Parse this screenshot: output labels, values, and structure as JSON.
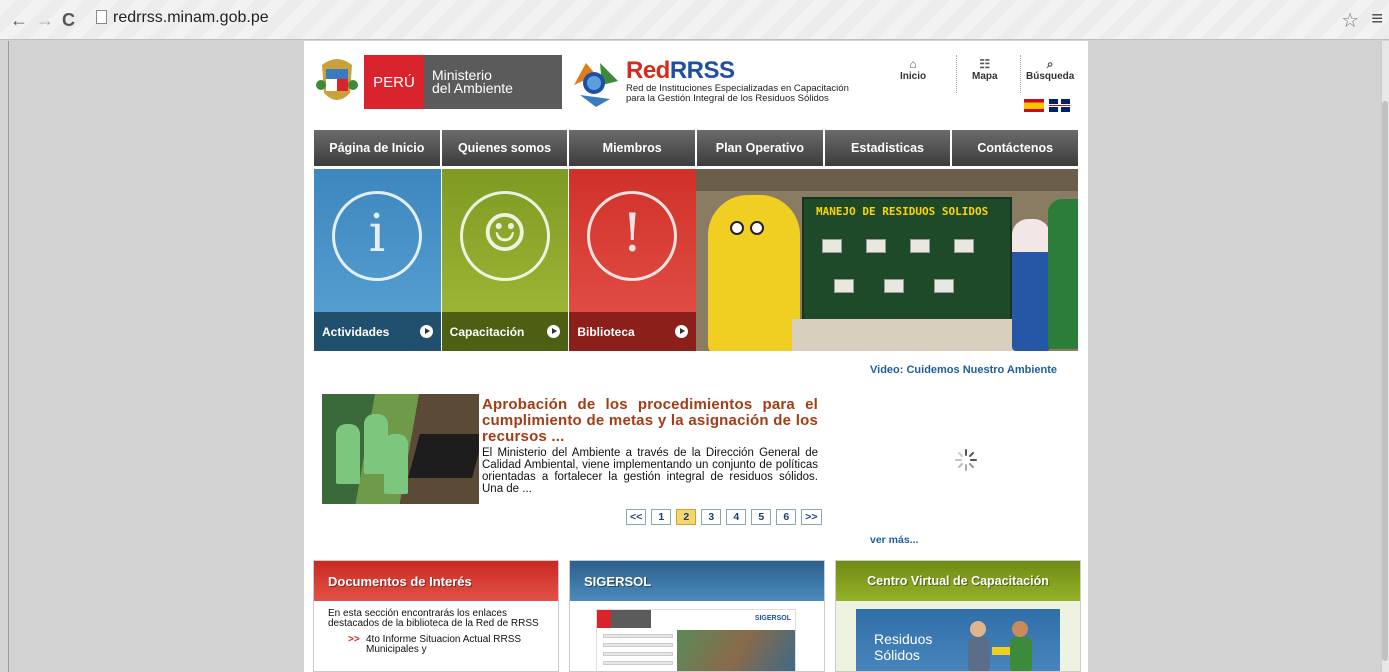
{
  "browser": {
    "url": "redrrss.minam.gob.pe",
    "back_glyph": "←",
    "forward_glyph": "→",
    "reload_glyph": "C",
    "star_glyph": "☆",
    "menu_glyph": "≡"
  },
  "header": {
    "peru_label": "PERÚ",
    "ministerio_line1": "Ministerio",
    "ministerio_line2": "del Ambiente",
    "rrss_title_red": "Red",
    "rrss_title_blue": "RRSS",
    "rrss_sub_line1": "Red de Instituciones Especializadas en Capacitación",
    "rrss_sub_line2": "para la Gestión Integral de los Residuos Sólidos",
    "toplinks": [
      {
        "label": "Inicio",
        "icon": "home-icon",
        "glyph": "⌂"
      },
      {
        "label": "Mapa",
        "icon": "sitemap-icon",
        "glyph": "☷"
      },
      {
        "label": "Búsqueda",
        "icon": "search-icon",
        "glyph": "⌕"
      }
    ]
  },
  "menu": [
    "Página de Inicio",
    "Quienes somos",
    "Miembros",
    "Plan Operativo",
    "Estadisticas",
    "Contáctenos"
  ],
  "tiles": [
    {
      "label": "Actividades",
      "icon": "info-icon",
      "glyph": "i"
    },
    {
      "label": "Capacitación",
      "icon": "smiley-icon",
      "glyph": "☺"
    },
    {
      "label": "Biblioteca",
      "icon": "alert-icon",
      "glyph": "!"
    }
  ],
  "photo": {
    "board_title": "MANEJO DE RESIDUOS SOLIDOS"
  },
  "video_link": "Video: Cuidemos Nuestro Ambiente",
  "news": {
    "title": "Aprobación de los procedimientos para el cumplimiento de metas y la asignación de los recursos ...",
    "body": "El Ministerio del Ambiente a través de la Dirección General de Calidad Ambiental, viene implementando un conjunto de políticas orientadas a fortalecer la gestión integral de residuos sólidos. Una de ...",
    "pager": [
      "<<",
      "1",
      "2",
      "3",
      "4",
      "5",
      "6",
      ">>"
    ],
    "active_page": "2"
  },
  "ver_mas": "ver más...",
  "boxes": {
    "documentos": {
      "title": "Documentos de Interés",
      "desc": "En esta sección encontrarás los enlaces destacados de la biblioteca de la Red de RRSS",
      "items": [
        {
          "arrow": ">>",
          "text": "4to Informe Situacion Actual RRSS Municipales y"
        }
      ]
    },
    "sigersol": {
      "title": "SIGERSOL",
      "shot_label": "SIGERSOL"
    },
    "centro": {
      "title": "Centro Virtual de Capacitación",
      "tile_line1": "Residuos",
      "tile_line2": "Sólidos"
    }
  },
  "colors": {
    "accent_red": "#d9232d",
    "menu_gray": "#4a4a4a",
    "link_blue": "#1f5f99",
    "news_title": "#a53c14"
  }
}
